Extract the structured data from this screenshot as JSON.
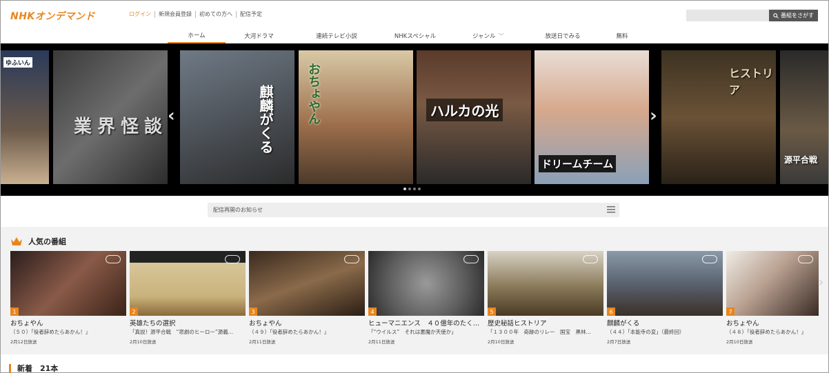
{
  "header": {
    "logo": "NHKオンデマンド",
    "links": [
      "ログイン",
      "新規会員登録",
      "初めての方へ",
      "配信予定"
    ],
    "search_placeholder": "",
    "search_label": "番組をさがす"
  },
  "nav": {
    "items": [
      "ホーム",
      "大河ドラマ",
      "連続テレビ小説",
      "NHKスペシャル",
      "ジャンル",
      "放送日でみる",
      "無料"
    ],
    "genre_chevron": "﹀"
  },
  "carousel": {
    "prev": "‹",
    "next": "›",
    "slides": [
      {
        "caption": "ゆふいん"
      },
      {
        "caption": "業界怪談"
      },
      {
        "caption": "麒麟がくる"
      },
      {
        "caption": "おちょやん"
      },
      {
        "caption": "ハルカの光"
      },
      {
        "caption": "ドリームチーム"
      },
      {
        "caption": "ヒストリア"
      },
      {
        "caption": "源平合戦"
      }
    ],
    "dot_count": 4
  },
  "notice": {
    "text": "配信再開のお知らせ"
  },
  "popular": {
    "title": "人気の番組",
    "next": "›",
    "items": [
      {
        "rank": "1",
        "title": "おちょやん",
        "subtitle": "（５０）「役者辞めたらあかん！」",
        "date": "2月12日放送"
      },
      {
        "rank": "2",
        "title": "英雄たちの選択",
        "subtitle": "「真説！源平合戦　“悲劇のヒーロー”源義…",
        "date": "2月10日放送"
      },
      {
        "rank": "3",
        "title": "おちょやん",
        "subtitle": "（４９）「役者辞めたらあかん！」",
        "date": "2月11日放送"
      },
      {
        "rank": "4",
        "title": "ヒューマニエンス　４０億年のたく…",
        "subtitle": "「“ウイルス”　それは悪魔か天使か」",
        "date": "2月11日放送"
      },
      {
        "rank": "5",
        "title": "歴史秘話ヒストリア",
        "subtitle": "「１３００年　奇跡のリレー　国宝　黒林…",
        "date": "2月10日放送"
      },
      {
        "rank": "6",
        "title": "麒麟がくる",
        "subtitle": "（４４）「本能寺の変」（最終回）",
        "date": "2月7日放送"
      },
      {
        "rank": "7",
        "title": "おちょやん",
        "subtitle": "（４８）「役者辞めたらあかん！」",
        "date": "2月10日放送"
      }
    ]
  },
  "new_section": {
    "title": "新着　21本"
  },
  "colors": {
    "accent": "#e8861e"
  }
}
